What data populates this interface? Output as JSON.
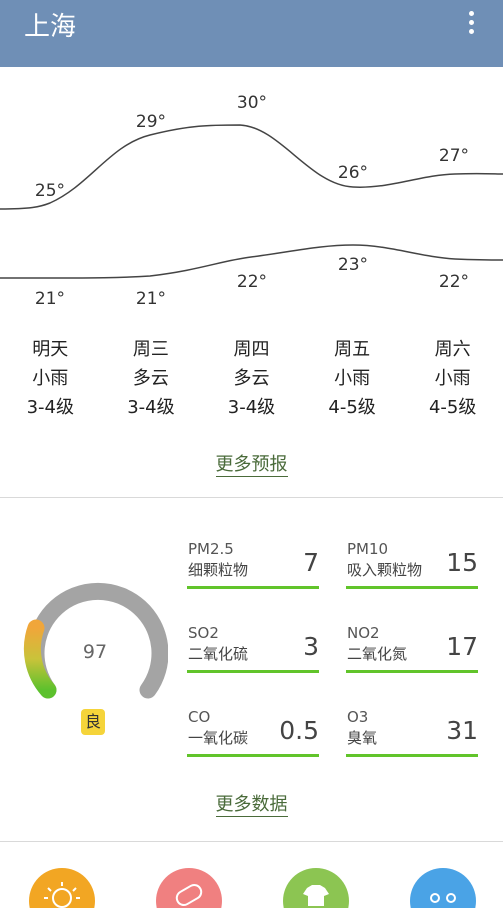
{
  "app": {
    "city": "上海"
  },
  "forecast": {
    "highs": [
      "25°",
      "29°",
      "30°",
      "26°",
      "27°"
    ],
    "lows": [
      "21°",
      "21°",
      "22°",
      "23°",
      "22°"
    ],
    "days": [
      {
        "day": "明天",
        "weather": "小雨",
        "wind": "3-4级"
      },
      {
        "day": "周三",
        "weather": "多云",
        "wind": "3-4级"
      },
      {
        "day": "周四",
        "weather": "多云",
        "wind": "3-4级"
      },
      {
        "day": "周五",
        "weather": "小雨",
        "wind": "4-5级"
      },
      {
        "day": "周六",
        "weather": "小雨",
        "wind": "4-5级"
      }
    ],
    "more_label": "更多预报"
  },
  "air_quality": {
    "aqi": "97",
    "level": "良",
    "pollutants": [
      {
        "code": "PM2.5",
        "name": "细颗粒物",
        "value": "7"
      },
      {
        "code": "PM10",
        "name": "吸入颗粒物",
        "value": "15"
      },
      {
        "code": "SO2",
        "name": "二氧化硫",
        "value": "3"
      },
      {
        "code": "NO2",
        "name": "二氧化氮",
        "value": "17"
      },
      {
        "code": "CO",
        "name": "一氧化碳",
        "value": "0.5"
      },
      {
        "code": "O3",
        "name": "臭氧",
        "value": "31"
      }
    ],
    "more_label": "更多数据"
  },
  "colors": {
    "appbar": "#6f8fb6",
    "indicator_green": "#61c42a",
    "icon_sun": "#f2a623",
    "icon_pill": "#f08080",
    "icon_shirt": "#8cc552",
    "icon_blue": "#4aa3e6"
  }
}
